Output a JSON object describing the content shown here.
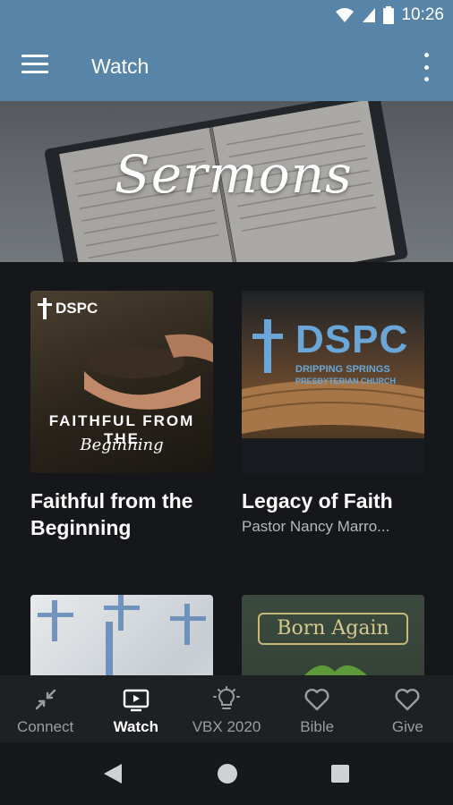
{
  "status": {
    "time": "10:26"
  },
  "appbar": {
    "title": "Watch"
  },
  "hero": {
    "title": "Sermons"
  },
  "cards": [
    {
      "title": "Faithful from the Beginning",
      "subtitle": "",
      "thumb_logo": "DSPC",
      "thumb_line1": "FAITHFUL FROM THE",
      "thumb_line2": "Beginning"
    },
    {
      "title": "Legacy of Faith",
      "subtitle": "Pastor Nancy Marro...",
      "thumb_logo": "DSPC",
      "thumb_line1": "DRIPPING SPRINGS",
      "thumb_line2": "PRESBYTERIAN CHURCH"
    },
    {
      "title": "",
      "subtitle": ""
    },
    {
      "title": "",
      "subtitle": "",
      "thumb_text": "Born Again"
    }
  ],
  "bottom_nav": [
    {
      "label": "Connect",
      "icon": "connect-icon"
    },
    {
      "label": "Watch",
      "icon": "tv-icon",
      "active": true
    },
    {
      "label": "VBX 2020",
      "icon": "lightbulb-icon"
    },
    {
      "label": "Bible",
      "icon": "heart-icon"
    },
    {
      "label": "Give",
      "icon": "heart-icon"
    }
  ],
  "colors": {
    "appbar": "#5884a8",
    "background": "#15171a",
    "nav_bg": "#1e2124",
    "nav_inactive": "#9a9da1"
  }
}
